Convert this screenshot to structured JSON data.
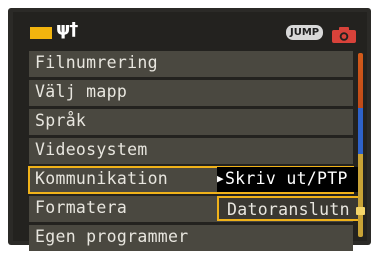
{
  "header": {
    "jump_label": "JUMP",
    "tabs": [
      {
        "icon": "folder-tab-icon",
        "color": "#f2b40e"
      },
      {
        "icon": "setup-tools-icon",
        "glyph": "ψ†"
      },
      {
        "icon": "camera-icon",
        "color": "#d44"
      }
    ]
  },
  "menu": {
    "items": [
      {
        "label": "Filnumrering"
      },
      {
        "label": "Välj mapp"
      },
      {
        "label": "Språk"
      },
      {
        "label": "Videosystem"
      },
      {
        "label": "Kommunikation",
        "selected": true
      },
      {
        "label": "Formatera"
      },
      {
        "label": "Egen programmer"
      }
    ]
  },
  "submenu": {
    "options": [
      {
        "label": "Skriv ut/PTP",
        "active": true
      },
      {
        "label": "Datoranslutn"
      }
    ]
  },
  "colors": {
    "accent": "#f0b21a",
    "background": "#23221f",
    "row": "#4a4840"
  }
}
